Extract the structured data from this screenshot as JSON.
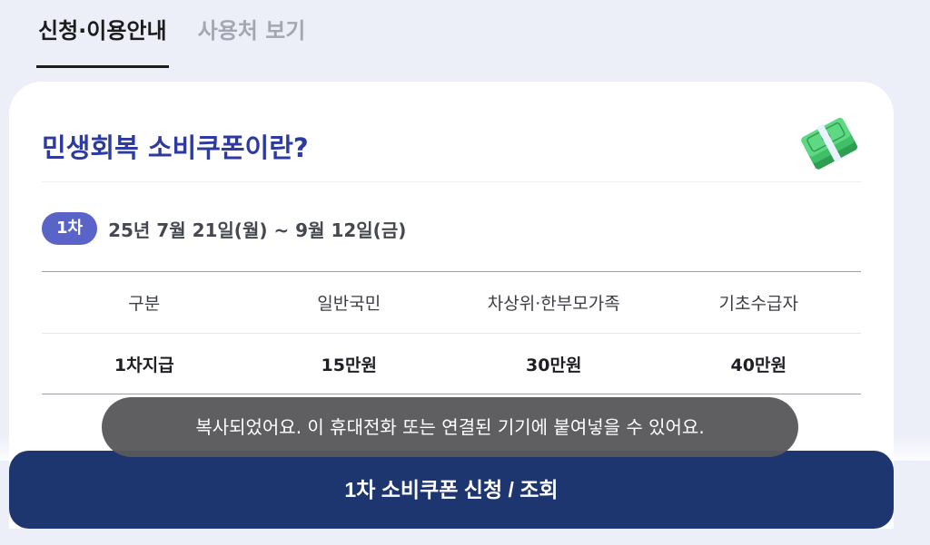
{
  "tabs": [
    {
      "label": "신청·이용안내",
      "active": true
    },
    {
      "label": "사용처 보기",
      "active": false
    }
  ],
  "card": {
    "title": "민생회복 소비쿠폰이란?",
    "icon": "money-stack-icon",
    "round_badge": "1차",
    "period": "25년 7월 21일(월) ~ 9월 12일(금)",
    "table": {
      "headers": [
        "구분",
        "일반국민",
        "차상위·한부모가족",
        "기초수급자"
      ],
      "rows": [
        [
          "1차지급",
          "15만원",
          "30만원",
          "40만원"
        ]
      ]
    }
  },
  "toast": {
    "message": "복사되었어요. 이 휴대전화 또는 연결된 기기에 붙여넣을 수 있어요."
  },
  "cta": {
    "label": "1차 소비쿠폰 신청 / 조회"
  },
  "colors": {
    "background": "#eceef8",
    "title_accent": "#2d3aa0",
    "badge": "#5a63c8",
    "cta": "#1e3670"
  }
}
